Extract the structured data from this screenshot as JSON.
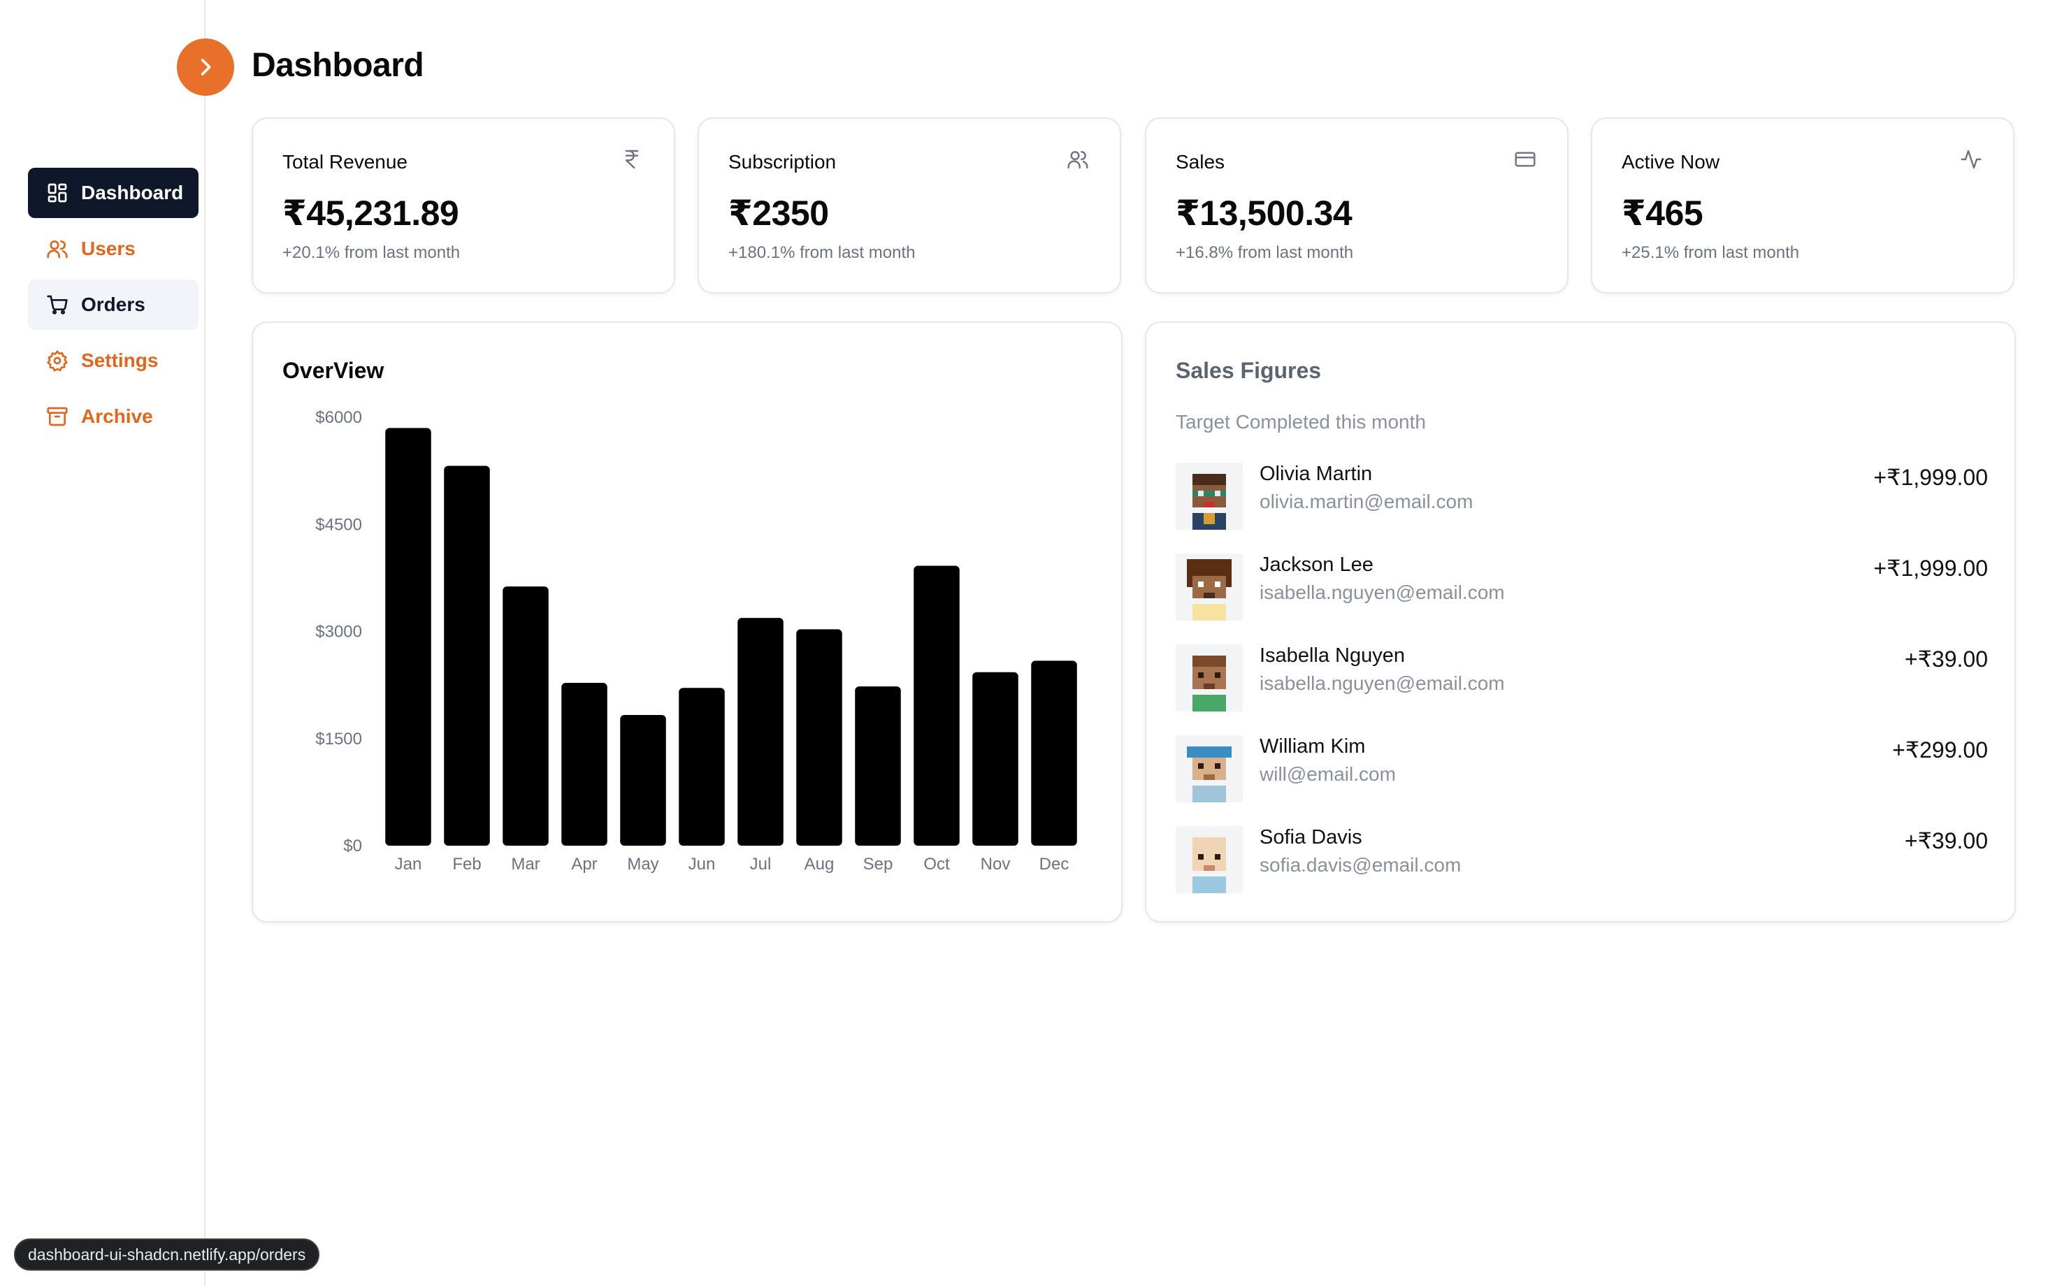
{
  "page": {
    "title": "Dashboard"
  },
  "sidebar": {
    "toggle_icon": "chevron-right-icon",
    "accent": "#e8702a",
    "items": [
      {
        "label": "Dashboard",
        "icon": "grid-icon",
        "state": "active"
      },
      {
        "label": "Users",
        "icon": "users-icon",
        "state": "normal"
      },
      {
        "label": "Orders",
        "icon": "cart-icon",
        "state": "hover"
      },
      {
        "label": "Settings",
        "icon": "gear-icon",
        "state": "normal"
      },
      {
        "label": "Archive",
        "icon": "archive-icon",
        "state": "normal"
      }
    ]
  },
  "stats": [
    {
      "title": "Total Revenue",
      "value": "₹45,231.89",
      "sub": "+20.1% from last month",
      "icon": "rupee-icon"
    },
    {
      "title": "Subscription",
      "value": "₹2350",
      "sub": "+180.1% from last month",
      "icon": "users-icon"
    },
    {
      "title": "Sales",
      "value": "₹13,500.34",
      "sub": "+16.8% from last month",
      "icon": "credit-card-icon"
    },
    {
      "title": "Active Now",
      "value": "₹465",
      "sub": "+25.1% from last month",
      "icon": "activity-icon"
    }
  ],
  "overview": {
    "title": "OverView"
  },
  "chart_data": {
    "type": "bar",
    "categories": [
      "Jan",
      "Feb",
      "Mar",
      "Apr",
      "May",
      "Jun",
      "Jul",
      "Aug",
      "Sep",
      "Oct",
      "Nov",
      "Dec"
    ],
    "values": [
      5850,
      5320,
      3630,
      2280,
      1830,
      2210,
      3190,
      3030,
      2230,
      3920,
      2430,
      2590
    ],
    "yticks": [
      "$0",
      "$1500",
      "$3000",
      "$4500",
      "$6000"
    ],
    "ylim": [
      0,
      6000
    ],
    "bar_color": "#000000",
    "grid": false,
    "legend": "none",
    "title": "OverView",
    "xlabel": "",
    "ylabel": ""
  },
  "sales_figures": {
    "title": "Sales Figures",
    "subtitle": "Target Completed this month",
    "rows": [
      {
        "name": "Olivia Martin",
        "email": "olivia.martin@email.com",
        "amount": "+₹1,999.00",
        "avatar": "pixel-avatar-glasses"
      },
      {
        "name": "Jackson Lee",
        "email": "isabella.nguyen@email.com",
        "amount": "+₹1,999.00",
        "avatar": "pixel-avatar-curly"
      },
      {
        "name": "Isabella Nguyen",
        "email": "isabella.nguyen@email.com",
        "amount": "+₹39.00",
        "avatar": "pixel-avatar-short"
      },
      {
        "name": "William Kim",
        "email": "will@email.com",
        "amount": "+₹299.00",
        "avatar": "pixel-avatar-cap"
      },
      {
        "name": "Sofia Davis",
        "email": "sofia.davis@email.com",
        "amount": "+₹39.00",
        "avatar": "pixel-avatar-bald"
      }
    ]
  },
  "status_bar": {
    "url": "dashboard-ui-shadcn.netlify.app/orders"
  }
}
